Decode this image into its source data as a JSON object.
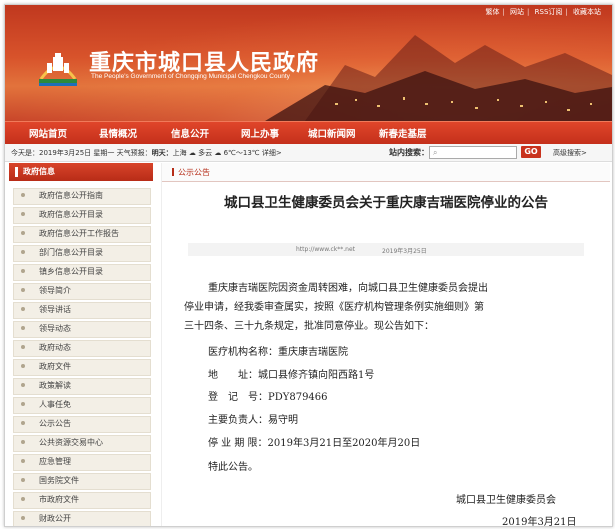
{
  "top_links": [
    "繁体",
    "网站",
    "RSS订阅",
    "收藏本站"
  ],
  "site": {
    "title": "重庆市城口县人民政府",
    "subtitle": "The People's Government of Chongqing Municipal Chengkou County"
  },
  "nav": [
    "网站首页",
    "县情概况",
    "信息公开",
    "网上办事",
    "城口新闻网",
    "新春走基层"
  ],
  "infobar": {
    "date_weather": "今天是：2019年3月25日 星期一  天气预报：",
    "today_label": "明天：",
    "city": "上海",
    "weather": "多云",
    "temp": "6℃～13℃",
    "detail": "详细>",
    "search_label": "站内搜索：",
    "search_placeholder": "",
    "go": "GO",
    "advanced": "高级搜索>"
  },
  "sidebar": {
    "title": "政府信息",
    "items": [
      "政府信息公开指南",
      "政府信息公开目录",
      "政府信息公开工作报告",
      "部门信息公开目录",
      "镇乡信息公开目录",
      "领导简介",
      "领导讲话",
      "领导动态",
      "政府动态",
      "政府文件",
      "政策解读",
      "人事任免",
      "公示公告",
      "公共资源交易中心",
      "应急管理",
      "国务院文件",
      "市政府文件",
      "财政公开"
    ]
  },
  "content": {
    "tab": "公示公告",
    "title": "城口县卫生健康委员会关于重庆康吉瑞医院停业的公告",
    "meta_url": "http://www.ck**.net",
    "meta_date": "2019年3月25日",
    "paragraph": [
      "重庆康吉瑞医院因资金周转困难，向城口县卫生健康委员会提出",
      "停业申请，经我委审查属实，按照《医疗机构管理条例实施细则》第",
      "三十四条、三十九条规定，批准同意停业。现公告如下："
    ],
    "fields": [
      "医疗机构名称：重庆康吉瑞医院",
      "地　　址：城口县修齐镇向阳西路1号",
      "登　记　号：PDY879466",
      "主要负责人：易守明",
      "停 业 期 限：2019年3月21日至2020年月20日",
      "特此公告。"
    ],
    "signature": "城口县卫生健康委员会",
    "sign_date": "2019年3月21日"
  },
  "colors": {
    "brand_red": "#c4301b",
    "sidebar_bg": "#f3efe6"
  }
}
